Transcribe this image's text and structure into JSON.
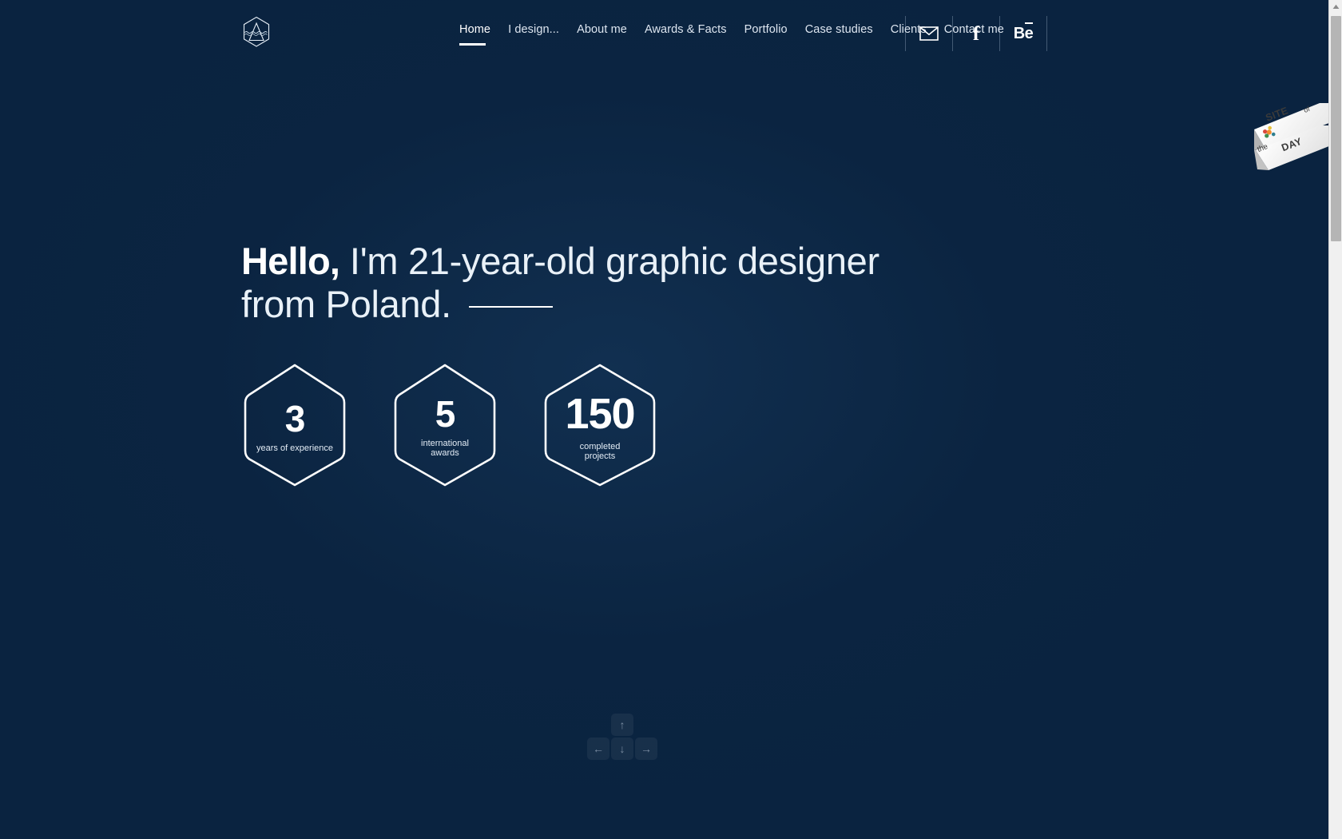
{
  "site": {
    "background_color": "#0a2340",
    "accent_color": "#ffffff",
    "logo_name": "hexagon-mountain-logo"
  },
  "header": {
    "nav": [
      {
        "label": "Home",
        "active": true
      },
      {
        "label": "I design...",
        "active": false
      },
      {
        "label": "About me",
        "active": false
      },
      {
        "label": "Awards & Facts",
        "active": false
      },
      {
        "label": "Portfolio",
        "active": false
      },
      {
        "label": "Case studies",
        "active": false
      },
      {
        "label": "Clients",
        "active": false
      },
      {
        "label": "Contact me",
        "active": false
      }
    ],
    "social": [
      {
        "name": "mail-icon",
        "label": "Email"
      },
      {
        "name": "facebook-icon",
        "label": "f"
      },
      {
        "name": "behance-icon",
        "label": "Be"
      }
    ]
  },
  "hero": {
    "greeting": "Hello,",
    "line1": " I'm 21-year-old graphic designer",
    "line2": "from Poland."
  },
  "badges": [
    {
      "number": "3",
      "label": "years of experience",
      "num_size": "46px"
    },
    {
      "number": "5",
      "label": "international\nawards",
      "label_line1": "international",
      "label_line2": "awards",
      "num_size": "46px"
    },
    {
      "number": "150",
      "label": "completed\nprojects",
      "label_line1": "completed",
      "label_line2": "projects",
      "num_size": "54px"
    }
  ],
  "ribbon": {
    "line1": "SITE",
    "of": "of",
    "the": "the",
    "line2": "DAY",
    "award_icon": "cssda-flower-icon"
  },
  "keys": {
    "up": "↑",
    "left": "←",
    "down": "↓",
    "right": "→"
  },
  "scrollbar": {
    "up_arrow": "▲"
  }
}
